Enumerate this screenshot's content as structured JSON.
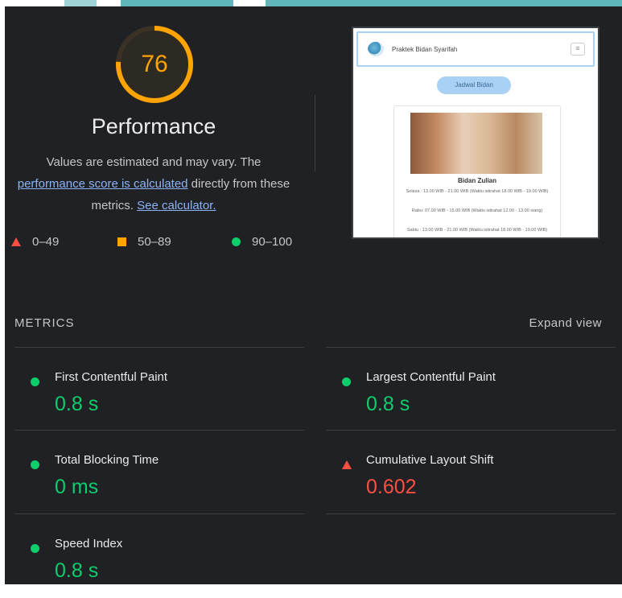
{
  "score": {
    "value": "76",
    "fraction": 0.76,
    "color": "#ffa400"
  },
  "category": {
    "title": "Performance",
    "description_pre": "Values are estimated and may vary. The ",
    "score_link": "performance score is calculated",
    "description_mid": " directly from these metrics. ",
    "calculator_link": "See calculator."
  },
  "legend": [
    {
      "icon": "fail-triangle-icon",
      "label": "0–49",
      "color": "#ff4e42"
    },
    {
      "icon": "average-square-icon",
      "label": "50–89",
      "color": "#ffa400"
    },
    {
      "icon": "pass-circle-icon",
      "label": "90–100",
      "color": "#0cce6b"
    }
  ],
  "screenshot": {
    "site_title": "Praktek Bidan Syarifah",
    "button": "Jadwal Bidan",
    "name": "Bidan Zulian",
    "lines": [
      "Selasa : 13.00 WIB - 21.00 WIB (Waktu istirahat 18.00 WIB - 19.00 WIB)",
      "Rabu: 07.00 WIB - 15.00 WIB (Waktu istirahat 12.00 - 13.00 siang)",
      "Sabtu : 13.00 WIB - 21.00 WIB (Waktu istirahat 18.00 WIB - 19.00 WIB)"
    ]
  },
  "metrics": {
    "header": "METRICS",
    "expand": "Expand view",
    "items": [
      {
        "title": "First Contentful Paint",
        "value": "0.8 s",
        "status": "pass"
      },
      {
        "title": "Largest Contentful Paint",
        "value": "0.8 s",
        "status": "pass"
      },
      {
        "title": "Total Blocking Time",
        "value": "0 ms",
        "status": "pass"
      },
      {
        "title": "Cumulative Layout Shift",
        "value": "0.602",
        "status": "fail"
      },
      {
        "title": "Speed Index",
        "value": "0.8 s",
        "status": "pass"
      }
    ]
  }
}
